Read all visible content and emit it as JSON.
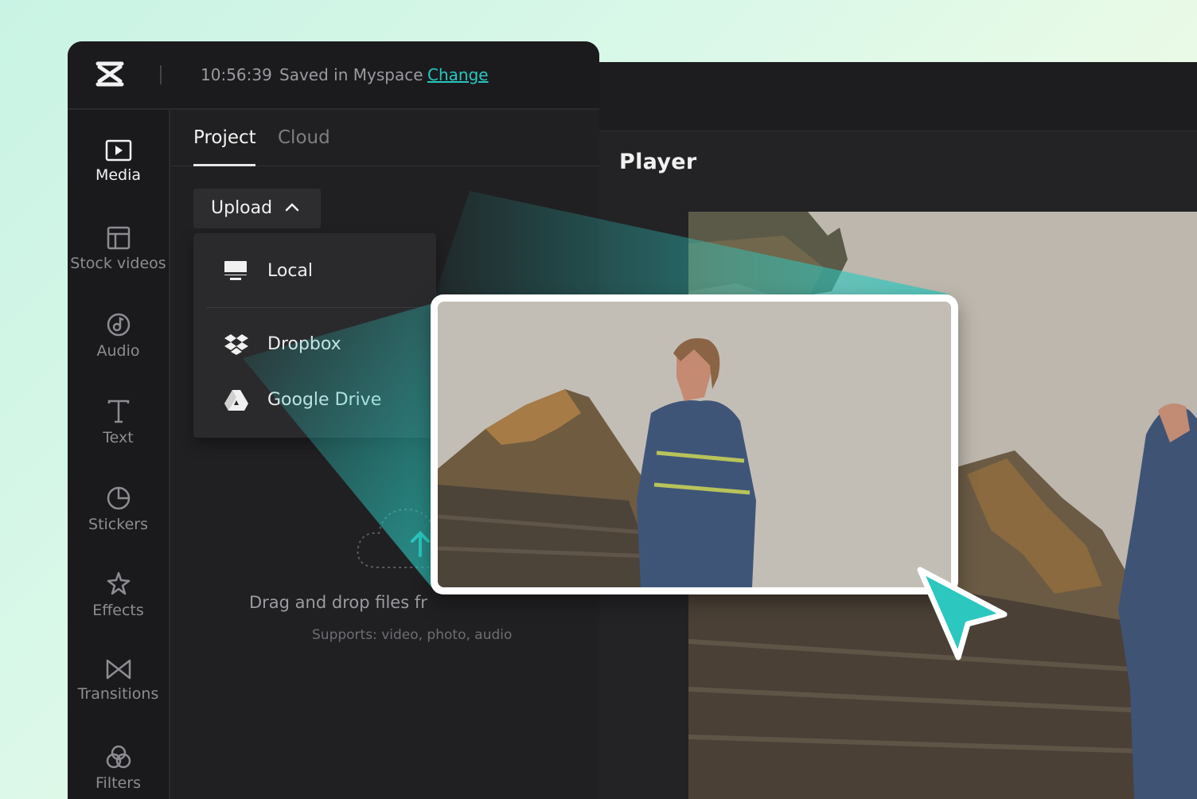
{
  "header": {
    "time": "10:56:39",
    "saved_text": "Saved in Myspace",
    "change_link": "Change"
  },
  "sidebar": {
    "items": [
      {
        "label": "Media",
        "icon": "media-icon",
        "active": true
      },
      {
        "label": "Stock videos",
        "icon": "stock-videos-icon",
        "active": false
      },
      {
        "label": "Audio",
        "icon": "audio-icon",
        "active": false
      },
      {
        "label": "Text",
        "icon": "text-icon",
        "active": false
      },
      {
        "label": "Stickers",
        "icon": "stickers-icon",
        "active": false
      },
      {
        "label": "Effects",
        "icon": "effects-icon",
        "active": false
      },
      {
        "label": "Transitions",
        "icon": "transitions-icon",
        "active": false
      },
      {
        "label": "Filters",
        "icon": "filters-icon",
        "active": false
      }
    ]
  },
  "tabs": [
    {
      "label": "Project",
      "active": true
    },
    {
      "label": "Cloud",
      "active": false
    }
  ],
  "upload": {
    "label": "Upload",
    "menu": [
      {
        "label": "Local",
        "icon": "monitor-icon"
      },
      {
        "label": "Dropbox",
        "icon": "dropbox-icon"
      },
      {
        "label": "Google Drive",
        "icon": "google-drive-icon"
      }
    ]
  },
  "dropzone": {
    "title": "Drag and drop files fr",
    "subtitle": "Supports: video, photo, audio"
  },
  "player": {
    "title": "Player"
  },
  "colors": {
    "accent": "#27c7c0",
    "panel": "#1e1e20",
    "cursor": "#2cc7bf"
  }
}
